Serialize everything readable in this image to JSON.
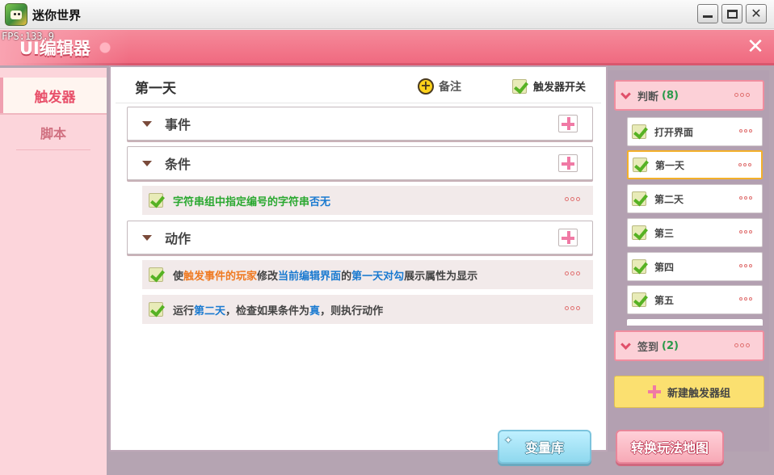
{
  "window": {
    "title": "迷你世界",
    "controls": [
      "minimize",
      "maximize",
      "close"
    ]
  },
  "header": {
    "title": "UI编辑器",
    "fps": "FPS:133.9",
    "close_icon": "✕"
  },
  "sidebar": {
    "tabs": [
      {
        "label": "触发器",
        "active": true
      },
      {
        "label": "脚本",
        "active": false
      }
    ]
  },
  "main": {
    "title": "第一天",
    "note_label": "备注",
    "trigger_toggle_label": "触发器开关",
    "trigger_toggle_checked": true,
    "sections": {
      "events": {
        "label": "事件"
      },
      "conditions": {
        "label": "条件"
      },
      "actions": {
        "label": "动作"
      }
    },
    "condition_entries": [
      {
        "checked": true,
        "text_parts": [
          "字符串组中指定编号的字符串",
          "否无"
        ]
      }
    ],
    "action_entries": [
      {
        "checked": true,
        "text_parts": [
          "使",
          "触发事件的玩家",
          "修改",
          "当前编辑界面",
          "的",
          "第一天对勾",
          "展示属性为显示"
        ]
      },
      {
        "checked": true,
        "text_parts": [
          "运行",
          "第二天",
          "，检查如果条件为",
          "真",
          "，则执行动作"
        ]
      }
    ]
  },
  "right_panel": {
    "groups": [
      {
        "label": "判断",
        "count": "(8)",
        "items": [
          {
            "label": "打开界面",
            "checked": true,
            "selected": false
          },
          {
            "label": "第一天",
            "checked": true,
            "selected": true
          },
          {
            "label": "第二天",
            "checked": true,
            "selected": false
          },
          {
            "label": "第三",
            "checked": true,
            "selected": false
          },
          {
            "label": "第四",
            "checked": true,
            "selected": false
          },
          {
            "label": "第五",
            "checked": true,
            "selected": false
          }
        ]
      },
      {
        "label": "签到",
        "count": "(2)",
        "items": []
      }
    ],
    "new_group_label": "新建触发器组"
  },
  "footer": {
    "variable_button": "变量库",
    "convert_button": "转换玩法地图"
  },
  "colors": {
    "accent_pink": "#f06a80",
    "highlight_green": "#2aa830",
    "highlight_blue": "#1a7ad0",
    "highlight_orange": "#ef7a22",
    "selected_border": "#f3b02a"
  }
}
